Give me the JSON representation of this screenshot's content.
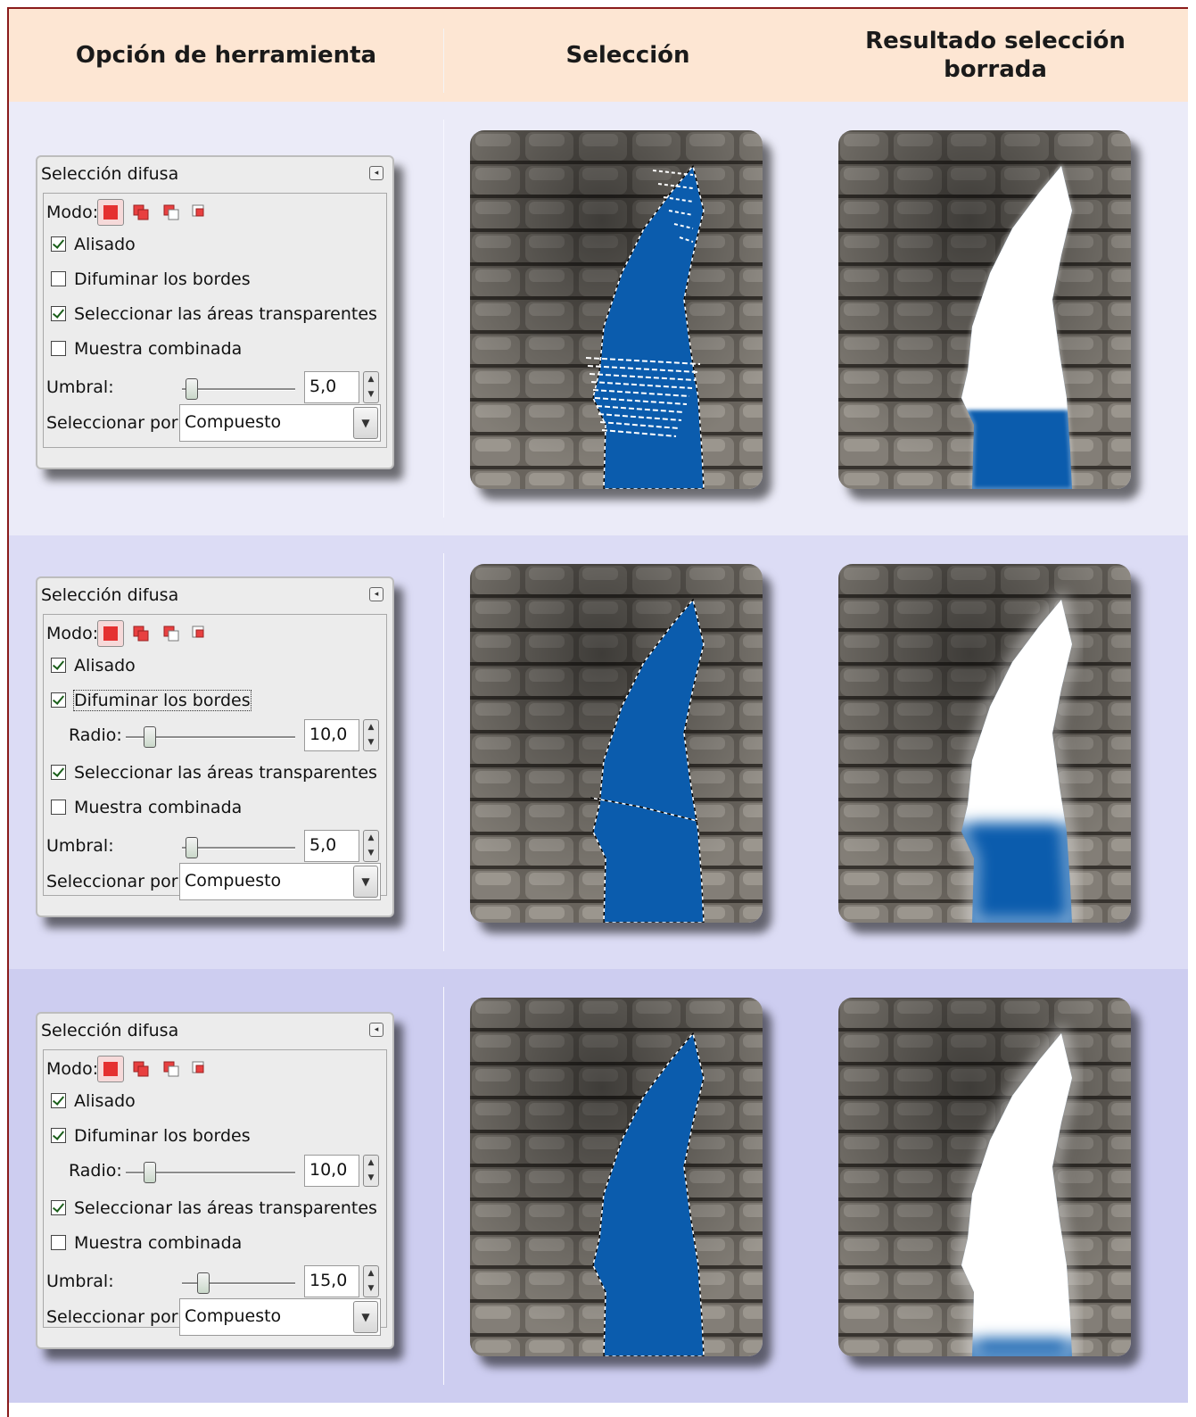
{
  "header": {
    "col1": "Opción de herramienta",
    "col2": "Selección",
    "col3_line1": "Resultado selección",
    "col3_line2": "borrada"
  },
  "panels": [
    {
      "title": "Selección difusa",
      "mode_label": "Modo:",
      "antialias": {
        "label": "Alisado",
        "checked": true
      },
      "feather": {
        "label": "Difuminar los bordes",
        "checked": false
      },
      "select_transparent": {
        "label": "Seleccionar las áreas transparentes",
        "checked": true
      },
      "sample_merged": {
        "label": "Muestra combinada",
        "checked": false
      },
      "threshold": {
        "label": "Umbral:",
        "value": "5,0",
        "fraction": 0.05
      },
      "select_by": {
        "label": "Seleccionar por:",
        "value": "Compuesto"
      }
    },
    {
      "title": "Selección difusa",
      "mode_label": "Modo:",
      "antialias": {
        "label": "Alisado",
        "checked": true
      },
      "feather": {
        "label": "Difuminar los bordes",
        "checked": true
      },
      "radius": {
        "label": "Radio:",
        "value": "10,0",
        "fraction": 0.1
      },
      "select_transparent": {
        "label": "Seleccionar las áreas transparentes",
        "checked": true
      },
      "sample_merged": {
        "label": "Muestra combinada",
        "checked": false
      },
      "threshold": {
        "label": "Umbral:",
        "value": "5,0",
        "fraction": 0.05
      },
      "select_by": {
        "label": "Seleccionar por:",
        "value": "Compuesto"
      }
    },
    {
      "title": "Selección difusa",
      "mode_label": "Modo:",
      "antialias": {
        "label": "Alisado",
        "checked": true
      },
      "feather": {
        "label": "Difuminar los bordes",
        "checked": true
      },
      "radius": {
        "label": "Radio:",
        "value": "10,0",
        "fraction": 0.1
      },
      "select_transparent": {
        "label": "Seleccionar las áreas transparentes",
        "checked": true
      },
      "sample_merged": {
        "label": "Muestra combinada",
        "checked": false
      },
      "threshold": {
        "label": "Umbral:",
        "value": "15,0",
        "fraction": 0.15
      },
      "select_by": {
        "label": "Seleccionar por:",
        "value": "Compuesto"
      }
    }
  ],
  "colors": {
    "header_bg": "#fde6d3",
    "row1_bg": "#ebebf8",
    "row2_bg": "#dcdcf5",
    "row3_bg": "#cdcdf0",
    "sky_blue": "#0b5cad",
    "stone": "#6e6962",
    "border": "#8a1b1b"
  }
}
